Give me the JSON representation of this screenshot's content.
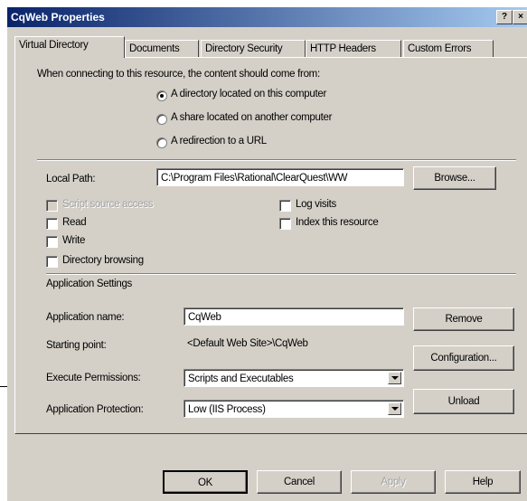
{
  "window": {
    "title": "CqWeb Properties",
    "help_btn": "?",
    "close_btn": "×"
  },
  "tabs": [
    "Virtual Directory",
    "Documents",
    "Directory Security",
    "HTTP Headers",
    "Custom Errors"
  ],
  "source": {
    "intro": "When connecting to this resource, the content should come from:",
    "options": [
      {
        "label": "A directory located on this computer",
        "selected": true
      },
      {
        "label": "A share located on another computer",
        "selected": false
      },
      {
        "label": "A redirection to a URL",
        "selected": false
      }
    ]
  },
  "local_path": {
    "label": "Local Path:",
    "value": "C:\\Program Files\\Rational\\ClearQuest\\WW",
    "browse": "Browse..."
  },
  "access": {
    "script_source": {
      "label": "Script source access",
      "checked": false,
      "disabled": true
    },
    "read": {
      "label": "Read",
      "checked": false
    },
    "write": {
      "label": "Write",
      "checked": false
    },
    "dir_browsing": {
      "label": "Directory browsing",
      "checked": false
    },
    "log_visits": {
      "label": "Log visits",
      "checked": false
    },
    "index_resource": {
      "label": "Index this resource",
      "checked": false
    }
  },
  "app_settings": {
    "heading": "Application Settings",
    "name_label": "Application name:",
    "name_value": "CqWeb",
    "remove": "Remove",
    "start_label": "Starting point:",
    "start_value": "<Default Web Site>\\CqWeb",
    "configuration": "Configuration...",
    "exec_label": "Execute Permissions:",
    "exec_value": "Scripts and Executables",
    "protect_label": "Application Protection:",
    "protect_value": "Low (IIS Process)",
    "unload": "Unload"
  },
  "footer": {
    "ok": "OK",
    "cancel": "Cancel",
    "apply": "Apply",
    "help": "Help"
  }
}
